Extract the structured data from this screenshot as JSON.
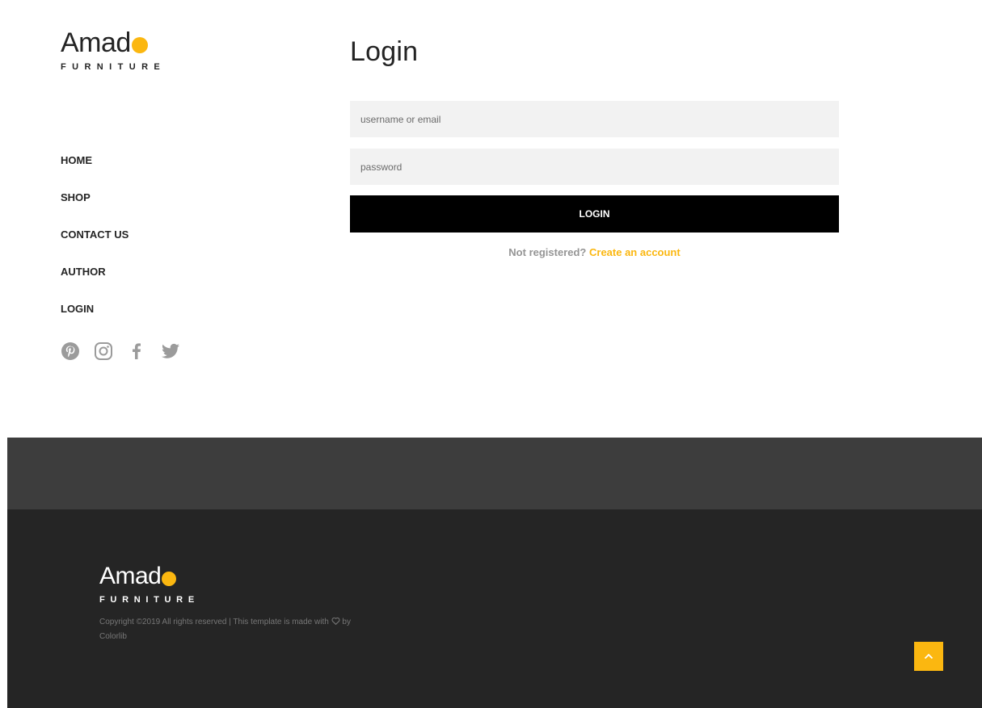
{
  "brand": {
    "name": "Amad",
    "tagline": "FURNITURE",
    "accent_color": "#fbb710"
  },
  "nav": {
    "items": [
      {
        "label": "HOME"
      },
      {
        "label": "SHOP"
      },
      {
        "label": "CONTACT US"
      },
      {
        "label": "AUTHOR"
      },
      {
        "label": "LOGIN"
      }
    ]
  },
  "social": {
    "icons": [
      "pinterest-icon",
      "instagram-icon",
      "facebook-icon",
      "twitter-icon"
    ],
    "icon_color": "#9b9b9b"
  },
  "login": {
    "title": "Login",
    "username_placeholder": "username or email",
    "password_placeholder": "password",
    "button_label": "LOGIN",
    "register_prompt": "Not registered?",
    "register_link": "Create an account"
  },
  "footer": {
    "brand_name": "Amad",
    "tagline": "FURNITURE",
    "copyright_line1": "Copyright ©2019 All rights reserved | This template is made",
    "copyright_with": "with",
    "copyright_by": "by Colorlib"
  },
  "scroll_top": {
    "icon": "chevron-up-icon"
  }
}
